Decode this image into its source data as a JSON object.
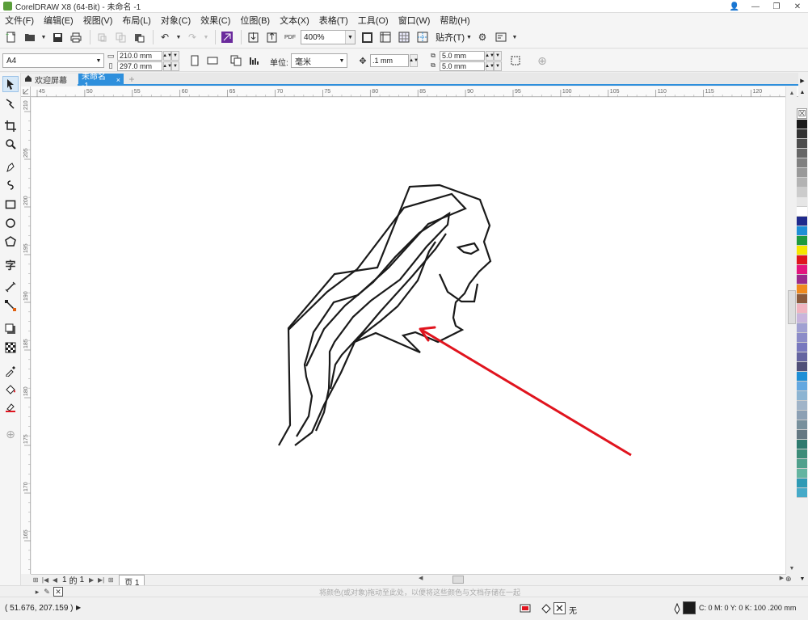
{
  "window": {
    "title": "CorelDRAW X8 (64-Bit) - 未命名 -1",
    "controls": [
      "👤",
      "—",
      "❐",
      "✕"
    ]
  },
  "menu": [
    "文件(F)",
    "编辑(E)",
    "视图(V)",
    "布局(L)",
    "对象(C)",
    "效果(C)",
    "位图(B)",
    "文本(X)",
    "表格(T)",
    "工具(O)",
    "窗口(W)",
    "帮助(H)"
  ],
  "toolbar": {
    "zoom": "400%",
    "snap_label": "贴齐(T)",
    "pdf_label": "PDF"
  },
  "property_bar": {
    "page_size": "A4",
    "width": "210.0 mm",
    "height": "297.0 mm",
    "units_label": "单位:",
    "units": "毫米",
    "nudge": ".1 mm",
    "dup_x": "5.0 mm",
    "dup_y": "5.0 mm"
  },
  "tabs": {
    "welcome": "欢迎屏幕",
    "document": "未命名 -1",
    "close": "×",
    "add": "+"
  },
  "ruler": {
    "h_ticks": [
      "45",
      "50",
      "55",
      "60",
      "65",
      "70",
      "75",
      "80",
      "85",
      "90",
      "95",
      "100",
      "105",
      "110",
      "115",
      "120"
    ],
    "v_ticks": [
      "210",
      "205",
      "200",
      "195",
      "190",
      "185",
      "180",
      "175",
      "170",
      "165"
    ]
  },
  "drawing": {
    "stroke_color": "#1a1a1a",
    "arrow_color": "#e0141e"
  },
  "palette": {
    "none_label": "☒",
    "colors": [
      "#1a1a1a",
      "#333333",
      "#4d4d4d",
      "#666666",
      "#808080",
      "#999999",
      "#b3b3b3",
      "#cccccc",
      "#e6e6e6",
      "#ffffff",
      "#1f2a8c",
      "#1e8fd6",
      "#1f9a3e",
      "#f5e500",
      "#e0141e",
      "#e3157d",
      "#9b2a8c",
      "#f08a1e",
      "#8a5a3c",
      "#f0b4c0",
      "#c8b4dc",
      "#a0a0d2",
      "#8c8cc8",
      "#7878be",
      "#6464a0",
      "#505078",
      "#1e8fd6",
      "#64a8e0",
      "#8cb4d2",
      "#a0b4c8",
      "#8ca0b4",
      "#78909c",
      "#647882",
      "#2e7a6e",
      "#3c8c78",
      "#50a08c",
      "#64b4a0",
      "#2e9ab4",
      "#46aac8"
    ]
  },
  "pagenav": {
    "current": "1",
    "of_label": "的",
    "total": "1",
    "page_tab": "页 1"
  },
  "hint": "将颜色(或对象)拖动至此处，以便将这些颜色与文档存储在一起",
  "status": {
    "coords": "( 51.676, 207.159 )",
    "fill": "无",
    "outline": "C: 0 M: 0 Y: 0 K: 100  .200 mm"
  }
}
